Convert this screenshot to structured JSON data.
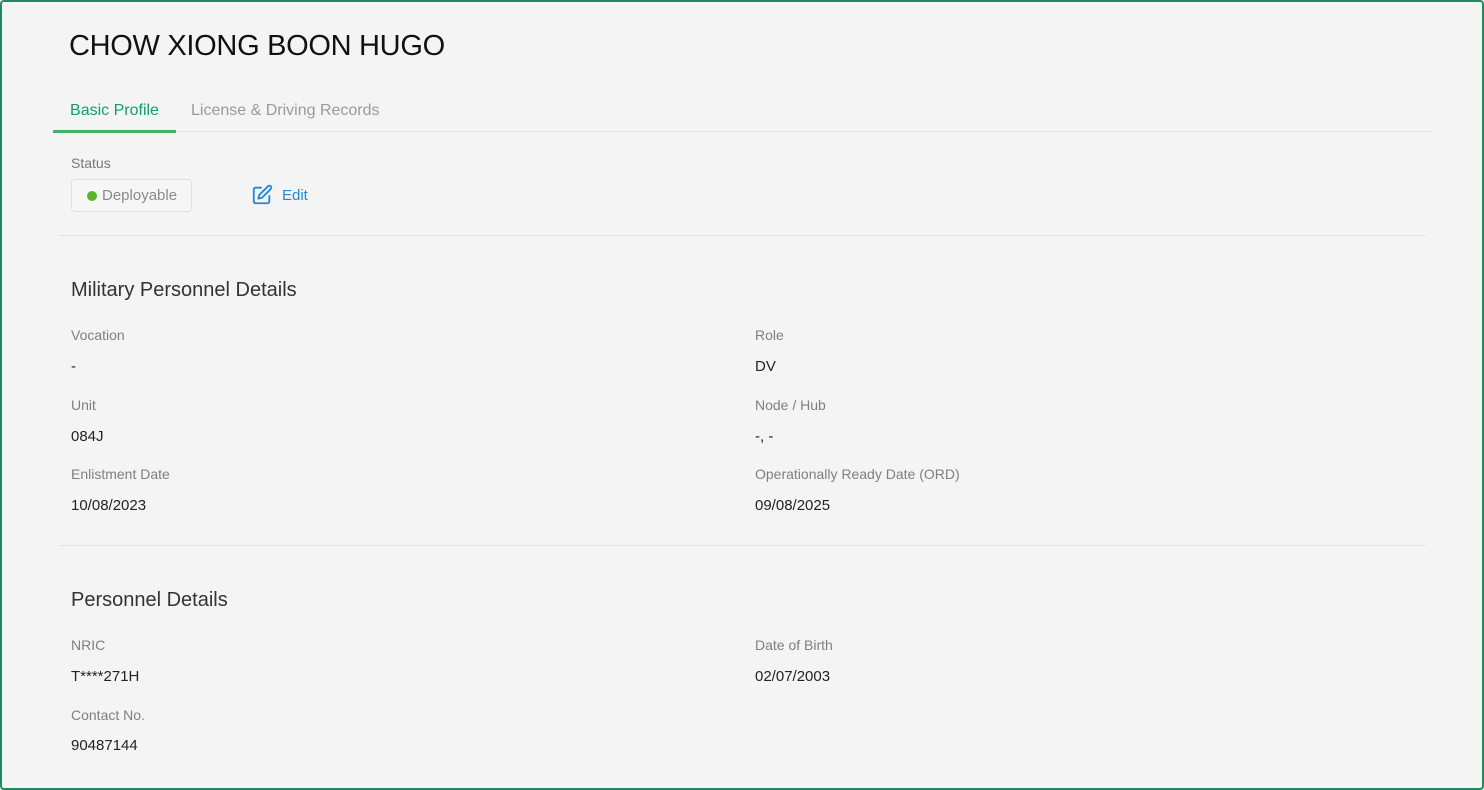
{
  "person": {
    "name": "CHOW XIONG BOON HUGO"
  },
  "tabs": [
    {
      "label": "Basic Profile",
      "active": true
    },
    {
      "label": "License & Driving Records",
      "active": false
    }
  ],
  "status": {
    "label": "Status",
    "value": "Deployable",
    "dot_color": "#58b52a",
    "edit_label": "Edit",
    "edit_icon": "edit-icon"
  },
  "military": {
    "title": "Military Personnel Details",
    "fields": [
      {
        "label": "Vocation",
        "value": "-"
      },
      {
        "label": "Role",
        "value": "DV"
      },
      {
        "label": "Unit",
        "value": "084J"
      },
      {
        "label": "Node / Hub",
        "value": "-, -"
      },
      {
        "label": "Enlistment Date",
        "value": "10/08/2023"
      },
      {
        "label": "Operationally Ready Date (ORD)",
        "value": "09/08/2025"
      }
    ]
  },
  "personnel": {
    "title": "Personnel Details",
    "fields": [
      {
        "label": "NRIC",
        "value": "T****271H"
      },
      {
        "label": "Date of Birth",
        "value": "02/07/2003"
      },
      {
        "label": "Contact No.",
        "value": "90487144"
      }
    ]
  },
  "colors": {
    "accent": "#159a75",
    "tab_underline": "#3fb36a",
    "link": "#1f88d8",
    "frame_border": "#1e8a5f"
  }
}
